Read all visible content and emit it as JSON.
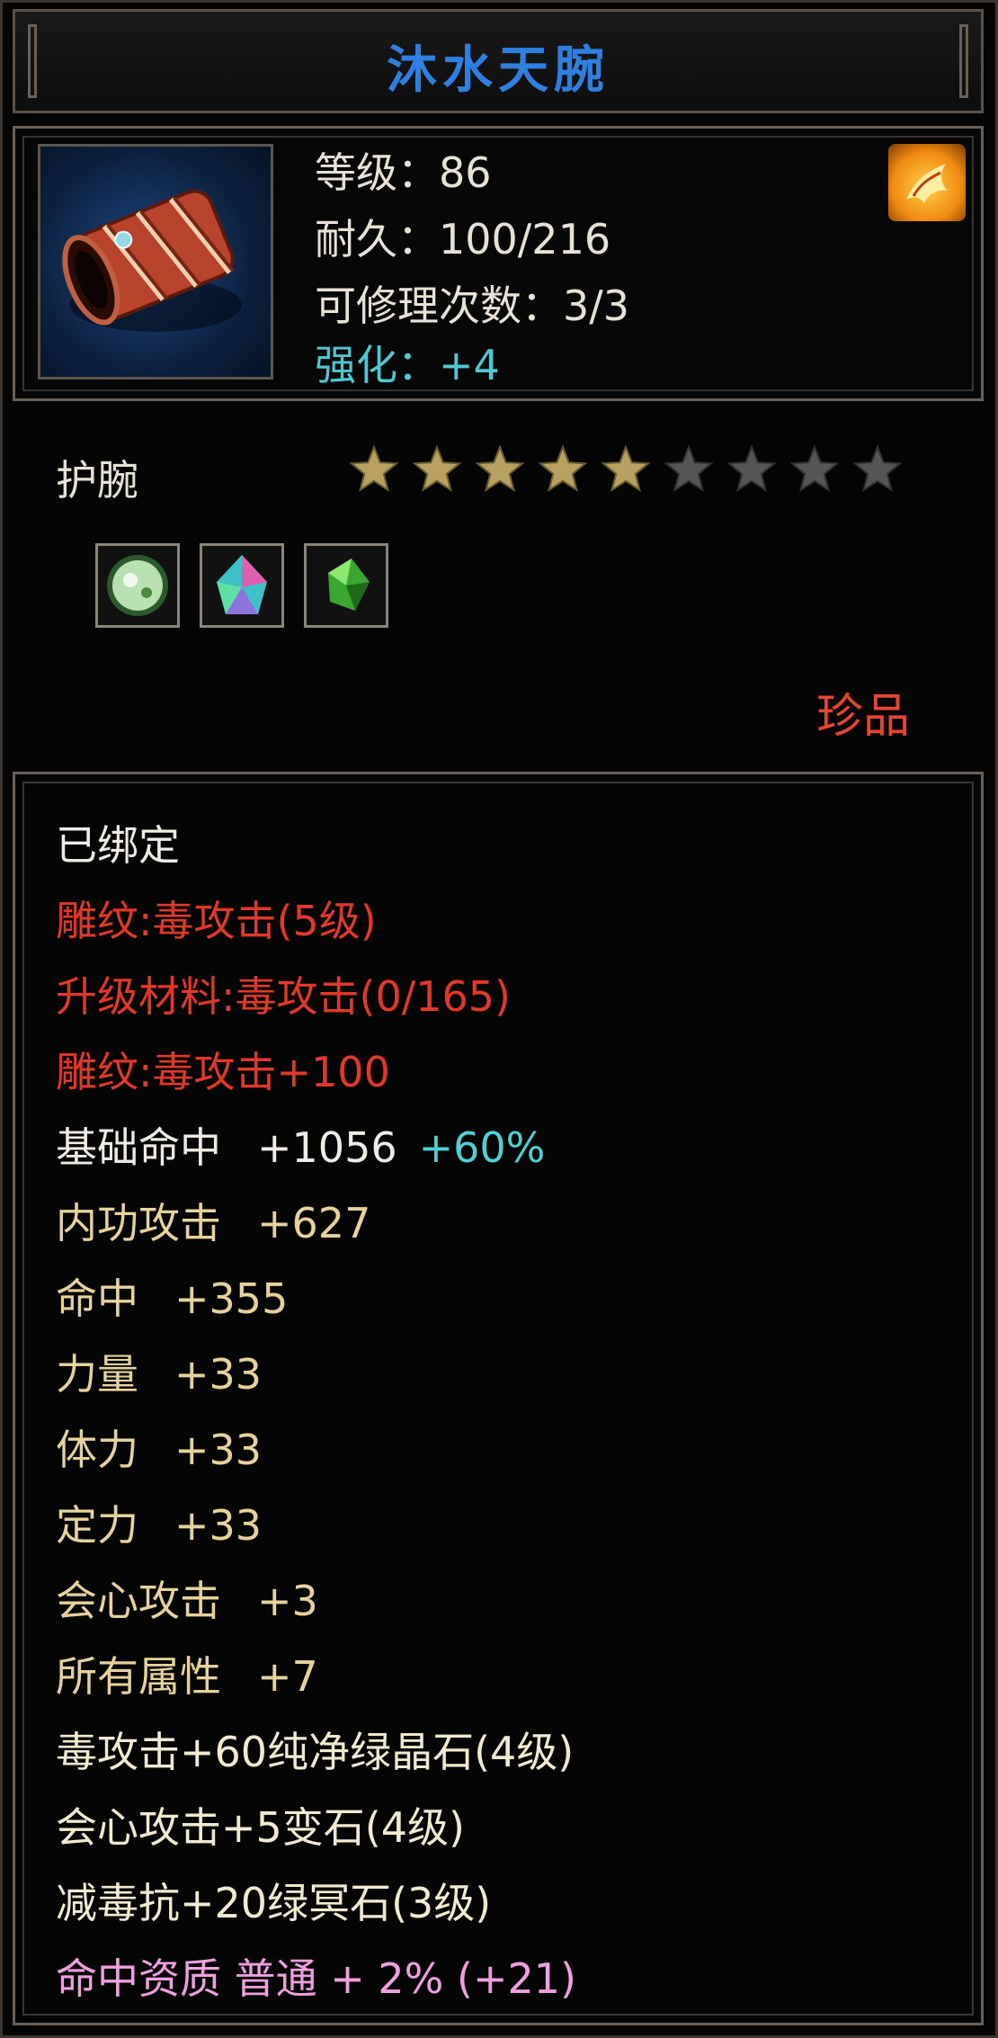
{
  "title": "沐水天腕",
  "header": {
    "level_label": "等级：86",
    "durability_label": "耐久：100/216",
    "repairs_label": "可修理次数：3/3",
    "enhance_label": "强化：+4"
  },
  "item_type": "护腕",
  "stars": {
    "filled": 5,
    "total": 9,
    "filled_color": "#b8a060",
    "empty_color": "#555555"
  },
  "gems": [
    "white-green-gem-icon",
    "rainbow-crystal-gem-icon",
    "green-gem-icon"
  ],
  "rarity": "珍品",
  "attributes": {
    "bound": "已绑定",
    "engrave1": "雕纹:毒攻击(5级)",
    "upgrade": "升级材料:毒攻击(0/165)",
    "engrave2": "雕纹:毒攻击+100",
    "base_hit": {
      "name": "基础命中",
      "value": "+1056",
      "bonus": "+60%"
    },
    "inner_attack": {
      "name": "内功攻击",
      "value": "+627"
    },
    "hit": {
      "name": "命中",
      "value": "+355"
    },
    "strength": {
      "name": "力量",
      "value": "+33"
    },
    "stamina": {
      "name": "体力",
      "value": "+33"
    },
    "focus": {
      "name": "定力",
      "value": "+33"
    },
    "crit": {
      "name": "会心攻击",
      "value": "+3"
    },
    "all_attr": {
      "name": "所有属性",
      "value": "+7"
    },
    "gem1": "毒攻击+60纯净绿晶石(4级)",
    "gem2": "会心攻击+5变石(4级)",
    "gem3": "减毒抗+20绿冥石(3级)",
    "quality": "命中资质 普通 + 2% (+21)"
  },
  "colors": {
    "title": "#2f7fe0",
    "red": "#e2382a",
    "gold": "#e6d29a",
    "cyan": "#4fd0d4",
    "pink": "#f0a0e0"
  }
}
